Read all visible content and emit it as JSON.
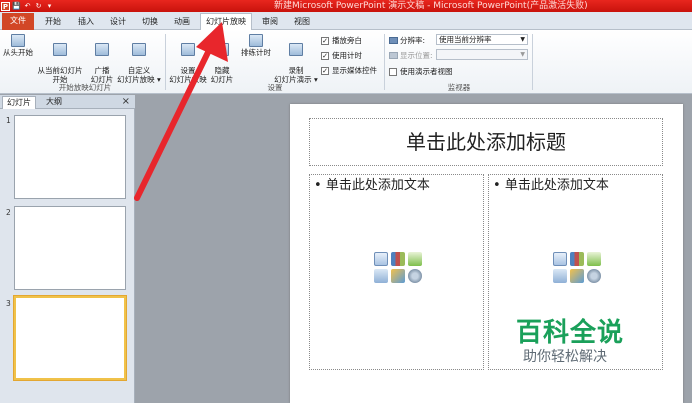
{
  "window": {
    "title": "新建Microsoft PowerPoint 演示文稿 - Microsoft PowerPoint(产品激活失败)",
    "qat": [
      "P",
      "💾",
      "↶",
      "↻",
      "▾"
    ]
  },
  "tabs": [
    {
      "label": "文件",
      "kind": "file"
    },
    {
      "label": "开始"
    },
    {
      "label": "插入"
    },
    {
      "label": "设计"
    },
    {
      "label": "切换"
    },
    {
      "label": "动画"
    },
    {
      "label": "幻灯片放映",
      "active": true
    },
    {
      "label": "审阅"
    },
    {
      "label": "视图"
    }
  ],
  "ribbon": {
    "start_group": {
      "label": "开始放映幻灯片",
      "buttons": [
        {
          "label": "从头开始",
          "icon": "play-from-start-icon"
        },
        {
          "label": "从当前幻灯片\n开始",
          "icon": "play-from-current-icon"
        },
        {
          "label": "广播\n幻灯片",
          "icon": "broadcast-icon"
        },
        {
          "label": "自定义\n幻灯片放映 ▾",
          "icon": "custom-show-icon"
        }
      ]
    },
    "setup_group": {
      "label": "设置",
      "buttons": [
        {
          "label": "设置\n幻灯片放映",
          "icon": "setup-show-icon"
        },
        {
          "label": "隐藏\n幻灯片",
          "icon": "hide-slide-icon"
        },
        {
          "label": "排练计时",
          "icon": "rehearse-timings-icon"
        },
        {
          "label": "录制\n幻灯片演示 ▾",
          "icon": "record-icon"
        }
      ],
      "checkboxes": [
        {
          "label": "播放旁白",
          "checked": true
        },
        {
          "label": "使用计时",
          "checked": true
        },
        {
          "label": "显示媒体控件",
          "checked": true
        }
      ]
    },
    "monitor_group": {
      "label": "监视器",
      "resolution_label": "分辨率:",
      "resolution_value": "使用当前分辨率",
      "show_on_label": "显示位置:",
      "show_on_value": "",
      "presenter_view_label": "使用演示者视图",
      "presenter_view_checked": false
    }
  },
  "left_panel": {
    "tabs": [
      "幻灯片",
      "大纲"
    ],
    "close": "×",
    "slides": [
      {
        "number": "1"
      },
      {
        "number": "2"
      },
      {
        "number": "3",
        "selected": true
      }
    ]
  },
  "slide": {
    "title_placeholder": "单击此处添加标题",
    "left_placeholder": "单击此处添加文本",
    "right_placeholder": "单击此处添加文本",
    "bullet": "•"
  },
  "watermark": {
    "main": "百科全说",
    "sub": "助你轻松解决"
  },
  "colors": {
    "titlebar": "#d41a12",
    "file_tab": "#d24726",
    "arrow": "#e8262c",
    "watermark_green": "#1aa05a"
  }
}
